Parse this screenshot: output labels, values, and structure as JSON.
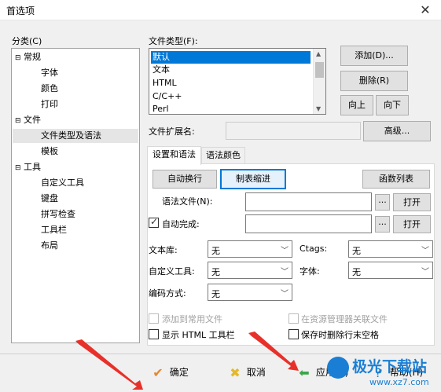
{
  "window": {
    "title": "首选项"
  },
  "left": {
    "label": "分类(C)",
    "tree": [
      {
        "label": "常规",
        "level": 0
      },
      {
        "label": "字体",
        "level": 1
      },
      {
        "label": "颜色",
        "level": 1
      },
      {
        "label": "打印",
        "level": 1
      },
      {
        "label": "文件",
        "level": 0
      },
      {
        "label": "文件类型及语法",
        "level": 1,
        "selected": true
      },
      {
        "label": "模板",
        "level": 1
      },
      {
        "label": "工具",
        "level": 0
      },
      {
        "label": "自定义工具",
        "level": 1
      },
      {
        "label": "键盘",
        "level": 1
      },
      {
        "label": "拼写检查",
        "level": 1
      },
      {
        "label": "工具栏",
        "level": 1
      },
      {
        "label": "布局",
        "level": 1
      }
    ]
  },
  "filetype": {
    "label": "文件类型(F):",
    "items": [
      "默认",
      "文本",
      "HTML",
      "C/C++",
      "Perl"
    ],
    "selected": "默认",
    "add_button": "添加(D)...",
    "delete_button": "删除(R)",
    "up_button": "向上",
    "down_button": "向下",
    "ext_label": "文件扩展名:",
    "advanced_button": "高级..."
  },
  "tabs": [
    {
      "label": "设置和语法",
      "active": true
    },
    {
      "label": "语法颜色",
      "active": false
    }
  ],
  "settings": {
    "wrap_button": "自动换行",
    "tab_indent_button": "制表缩进",
    "func_list_button": "函数列表",
    "syntax_file_label": "语法文件(N):",
    "autocomplete_label": "自动完成:",
    "autocomplete_checked": true,
    "ellipsis": "...",
    "open_button": "打开",
    "library_label": "文本库:",
    "library_value": "无",
    "ctags_label": "Ctags:",
    "ctags_value": "无",
    "custom_tool_label": "自定义工具:",
    "custom_tool_value": "无",
    "font_label": "字体:",
    "font_value": "无",
    "encoding_label": "编码方式:",
    "encoding_value": "无",
    "add_common_label": "添加到常用文件",
    "explorer_assoc_label": "在资源管理器关联文件",
    "show_html_toolbar_label": "显示 HTML 工具栏",
    "strip_trailing_label": "保存时删除行末空格"
  },
  "footer": {
    "ok_button": "确定",
    "cancel_button": "取消",
    "apply_button": "应用(A)",
    "help_button": "帮助(H)",
    "watermark_title": "极光下载站",
    "watermark_url": "www.xz7.com"
  },
  "colors": {
    "accent": "#0078d7",
    "arrow_red": "#e8302a",
    "ok_orange": "#e8852a",
    "cancel_yellow": "#e5b82a",
    "apply_green": "#3aa64a",
    "watermark_blue": "#1a7fd4"
  }
}
